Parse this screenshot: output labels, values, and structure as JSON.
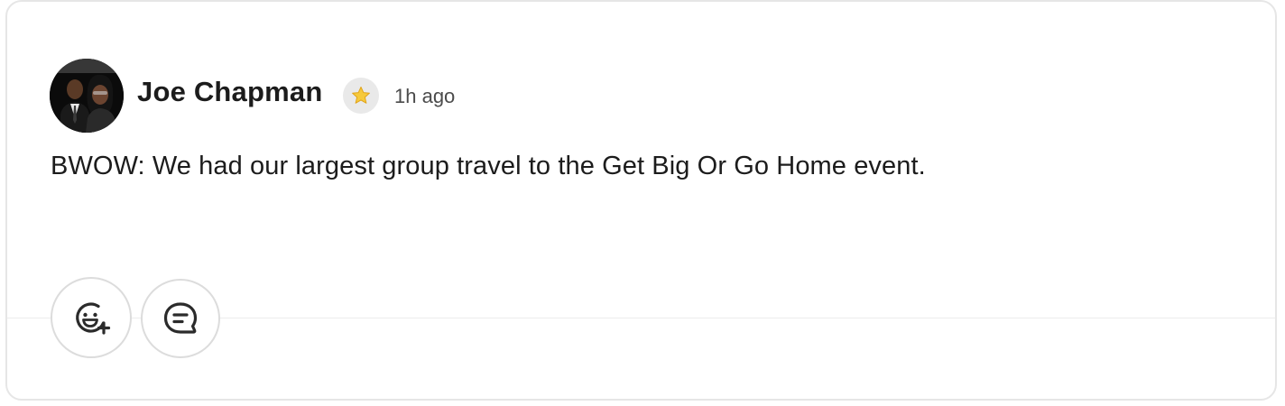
{
  "post": {
    "author": "Joe Chapman",
    "time": "1h ago",
    "body": "BWOW: We had our largest group travel to the Get Big Or Go Home event.",
    "badge_icon": "star-icon",
    "badge_color": "#f5c518"
  },
  "actions": {
    "react_icon": "emoji-add-icon",
    "comment_icon": "comment-icon"
  },
  "colors": {
    "text": "#1c1c1c",
    "muted": "#4b4b4b",
    "border": "#e6e6e6",
    "badge_bg": "#e9e9e9"
  }
}
